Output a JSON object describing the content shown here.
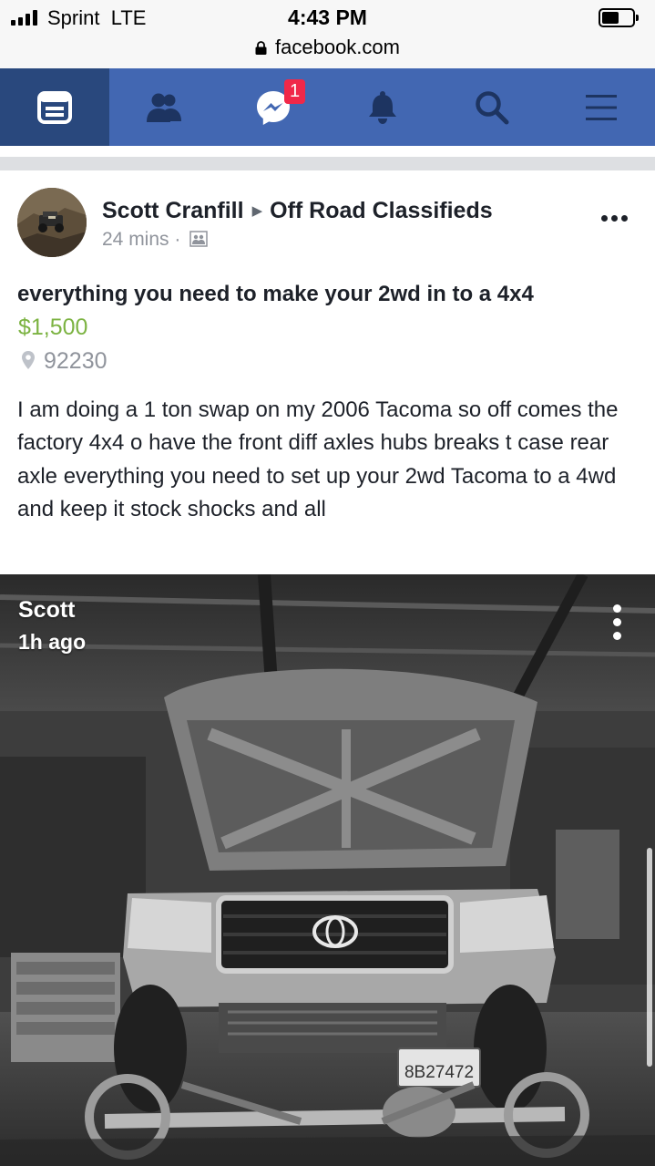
{
  "status_bar": {
    "carrier": "Sprint",
    "network": "LTE",
    "time": "4:43 PM",
    "url": "facebook.com",
    "battery_level": 0.55,
    "signal_bars": 4
  },
  "nav": {
    "items": [
      {
        "id": "news-feed",
        "icon": "news-feed-icon",
        "active": true
      },
      {
        "id": "friends",
        "icon": "friends-icon",
        "active": false
      },
      {
        "id": "messenger",
        "icon": "messenger-icon",
        "active": false,
        "badge": "1"
      },
      {
        "id": "notifications",
        "icon": "bell-icon",
        "active": false
      },
      {
        "id": "search",
        "icon": "search-icon",
        "active": false
      },
      {
        "id": "menu",
        "icon": "hamburger-menu-icon",
        "active": false
      }
    ],
    "colors": {
      "bar": "#4267b2",
      "active": "#29487d",
      "badge": "#f02849"
    }
  },
  "post": {
    "author": "Scott Cranfill",
    "group": "Off Road Classifieds",
    "time": "24 mins",
    "separator": "·",
    "audience_icon": "group-icon",
    "title": "everything you need to make your 2wd in to a 4x4",
    "price": "$1,500",
    "location": "92230",
    "description": "I am doing a 1 ton swap on my 2006 Tacoma so off comes the factory 4x4 o have the front diff axles hubs breaks t case rear axle everything you need to set up your 2wd Tacoma to a 4wd and keep it stock shocks and all",
    "price_color": "#7cb342"
  },
  "photo": {
    "story_name": "Scott",
    "story_time": "1h ago",
    "plate": "8B27472",
    "description_icon": "toyota-tacoma-photo"
  }
}
